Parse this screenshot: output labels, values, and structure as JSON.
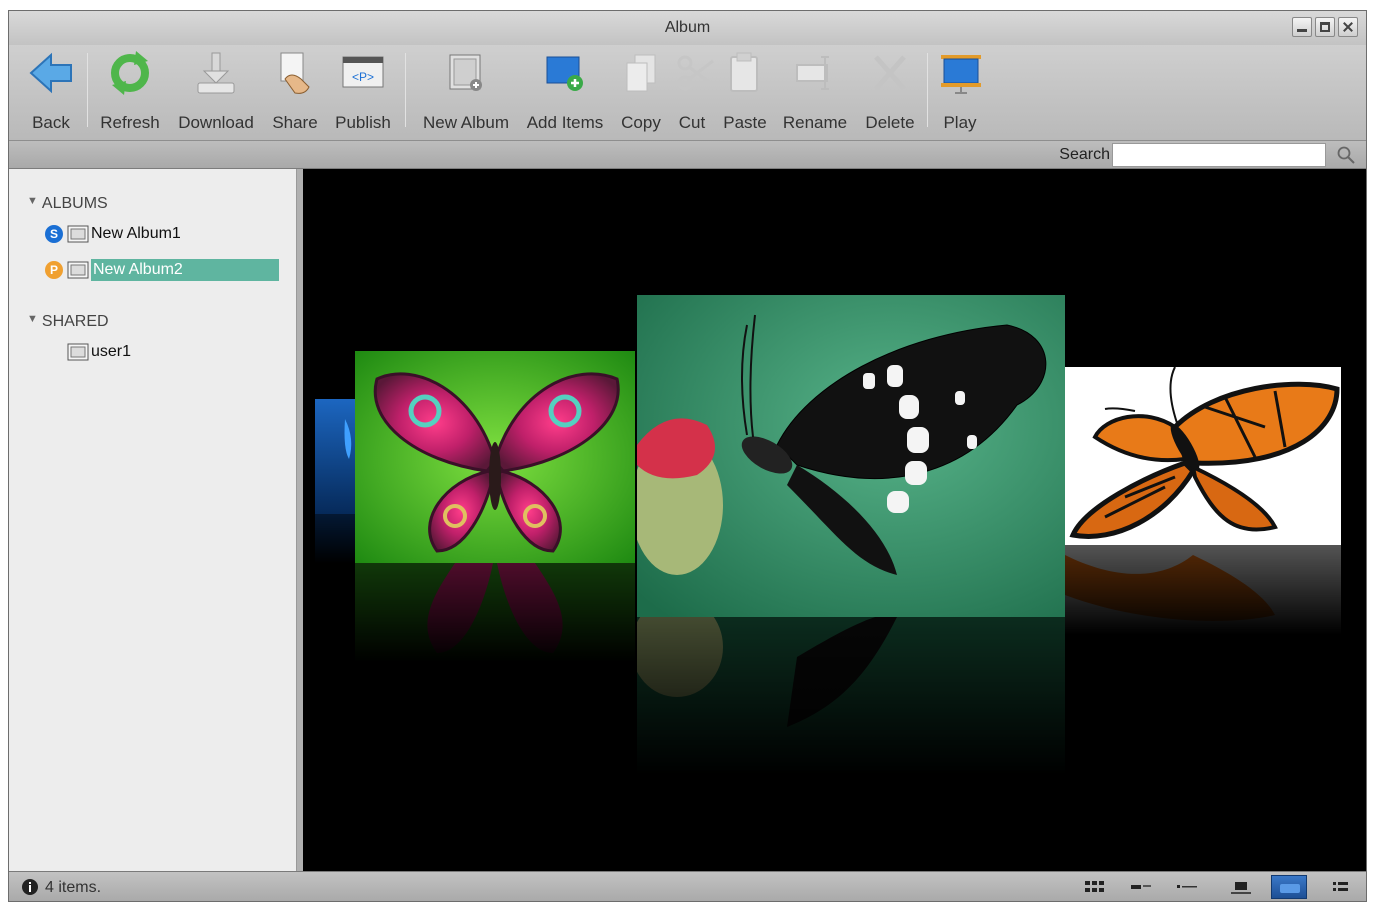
{
  "window": {
    "title": "Album"
  },
  "toolbar": {
    "items": [
      {
        "label": "Back",
        "icon": "back-arrow-icon"
      },
      {
        "label": "Refresh",
        "icon": "refresh-icon"
      },
      {
        "label": "Download",
        "icon": "download-icon"
      },
      {
        "label": "Share",
        "icon": "share-icon"
      },
      {
        "label": "Publish",
        "icon": "publish-icon"
      },
      {
        "label": "New Album",
        "icon": "new-album-icon"
      },
      {
        "label": "Add Items",
        "icon": "add-items-icon"
      },
      {
        "label": "Copy",
        "icon": "copy-icon"
      },
      {
        "label": "Cut",
        "icon": "cut-icon"
      },
      {
        "label": "Paste",
        "icon": "paste-icon"
      },
      {
        "label": "Rename",
        "icon": "rename-icon"
      },
      {
        "label": "Delete",
        "icon": "delete-icon"
      },
      {
        "label": "Play",
        "icon": "play-slideshow-icon"
      }
    ]
  },
  "search": {
    "label": "Search",
    "value": ""
  },
  "sidebar": {
    "albums_header": "ALBUMS",
    "albums": [
      {
        "label": "New Album1",
        "badge": "S",
        "selected": false
      },
      {
        "label": "New Album2",
        "badge": "P",
        "selected": true
      }
    ],
    "shared_header": "SHARED",
    "shared": [
      {
        "label": "user1"
      }
    ]
  },
  "viewer": {
    "photos": [
      {
        "name": "blue-butterfly-photo"
      },
      {
        "name": "psychedelic-butterfly-photo"
      },
      {
        "name": "black-swallowtail-butterfly-photo"
      },
      {
        "name": "monarch-butterfly-photo"
      }
    ]
  },
  "status": {
    "text": "4 items."
  },
  "colors": {
    "selection": "#5fb5a0",
    "badge_s": "#1a6fd4",
    "badge_p": "#f0a030",
    "viewer_background": "#000000",
    "active_view": "#2a64b0"
  }
}
